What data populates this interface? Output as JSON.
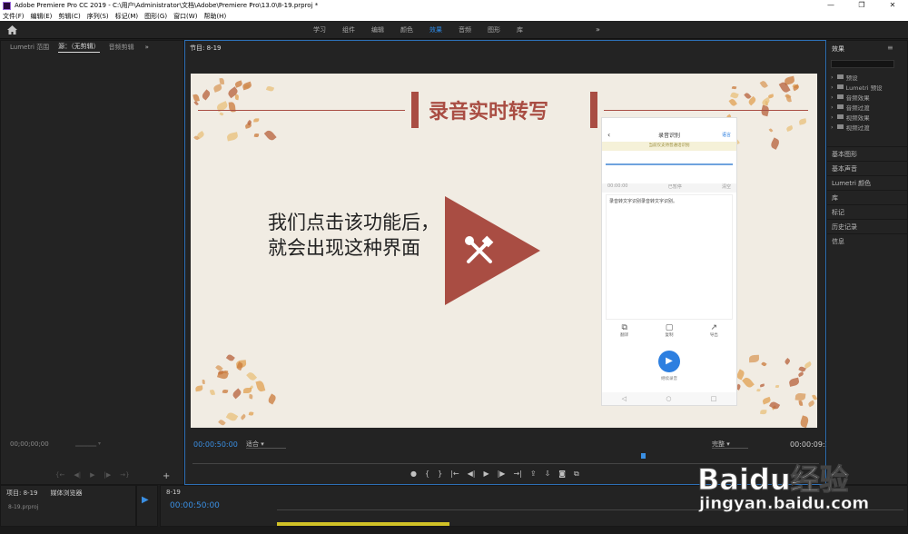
{
  "window": {
    "title": "Adobe Premiere Pro CC 2019 - C:\\用户\\Administrator\\文档\\Adobe\\Premiere Pro\\13.0\\8-19.prproj *",
    "controls": [
      "—",
      "❐",
      "✕"
    ]
  },
  "menu": [
    "文件(F)",
    "编辑(E)",
    "剪辑(C)",
    "序列(S)",
    "标记(M)",
    "图形(G)",
    "窗口(W)",
    "帮助(H)"
  ],
  "workspaces": {
    "tabs": [
      "学习",
      "组件",
      "编辑",
      "颜色",
      "效果",
      "音频",
      "图形",
      "库"
    ],
    "active": "效果",
    "more": "»"
  },
  "source_panel": {
    "tabs": [
      "Lumetri 范围",
      "源：（无剪辑）",
      "音频剪辑"
    ],
    "active_tab": "源：（无剪辑）",
    "timecode": "00;00;00;00",
    "more": "»"
  },
  "program_panel": {
    "title": "节目: 8-19",
    "timecode": "00:00:50:00",
    "fit": "适合",
    "quality": "完整",
    "duration": "00:00:09:19",
    "playhead_fraction": 0.716
  },
  "slide": {
    "title": "录音实时转写",
    "body": "我们点击该功能后，就会出现这种界面",
    "phone": {
      "status": "  ",
      "header": "录音识别",
      "header_right": "语言",
      "notice": "当前仅支持普通话识别",
      "rec_left": "00:00:00",
      "rec_mid": "已暂停",
      "rec_right": "清空",
      "body": "录音转文字识别录音转文字识别。",
      "actions": [
        {
          "icon": "⧉",
          "label": "翻译"
        },
        {
          "icon": "▢",
          "label": "复制"
        },
        {
          "icon": "↗",
          "label": "导出"
        }
      ],
      "play_label": "继续录音",
      "nav": [
        "◁",
        "○",
        "□"
      ]
    }
  },
  "effects_panel": {
    "title": "效果",
    "tree": [
      "预设",
      "Lumetri 预设",
      "音频效果",
      "音频过渡",
      "视频效果",
      "视频过渡"
    ],
    "sections": [
      "基本图形",
      "基本声音",
      "Lumetri 颜色",
      "库",
      "标记",
      "历史记录",
      "信息"
    ]
  },
  "project_panel": {
    "tabs": [
      "项目: 8-19",
      "媒体浏览器"
    ],
    "file": "8-19.prproj"
  },
  "timeline_panel": {
    "tab": "8-19",
    "timecode": "00:00:50:00"
  },
  "watermark": {
    "brand": "Baidu经验",
    "url": "jingyan.baidu.com"
  },
  "colors": {
    "accent": "#2d8ceb",
    "slide_red": "#a94d43",
    "slide_bg": "#f1ece3",
    "clip_yellow": "#d1c227"
  }
}
